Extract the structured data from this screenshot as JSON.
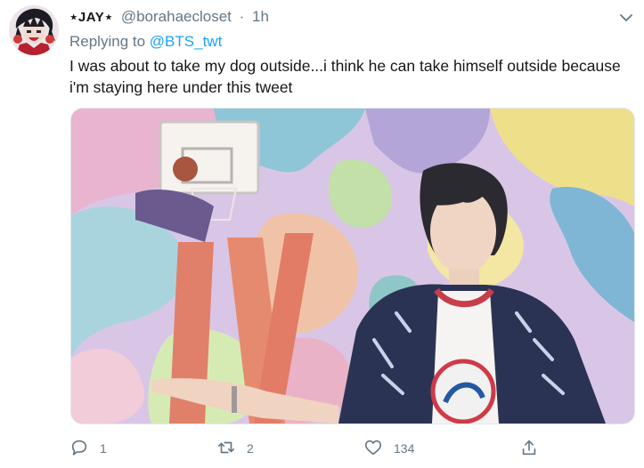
{
  "tweet": {
    "display_name": "⋆JAY⋆",
    "handle": "@borahaecloset",
    "separator": "·",
    "time": "1h",
    "reply_prefix": "Replying to",
    "reply_to": "@BTS_twt",
    "text": "I was about to take my dog outside...i think he can take himself outside because i'm staying here under this tweet"
  },
  "actions": {
    "reply_count": "1",
    "retweet_count": "2",
    "like_count": "134"
  },
  "colors": {
    "accent": "#1da1f2",
    "secondary_text": "#657786",
    "primary_text": "#14171a"
  },
  "icons": [
    "avatar",
    "chevron-down-icon",
    "reply-icon",
    "retweet-icon",
    "like-icon",
    "share-icon"
  ]
}
